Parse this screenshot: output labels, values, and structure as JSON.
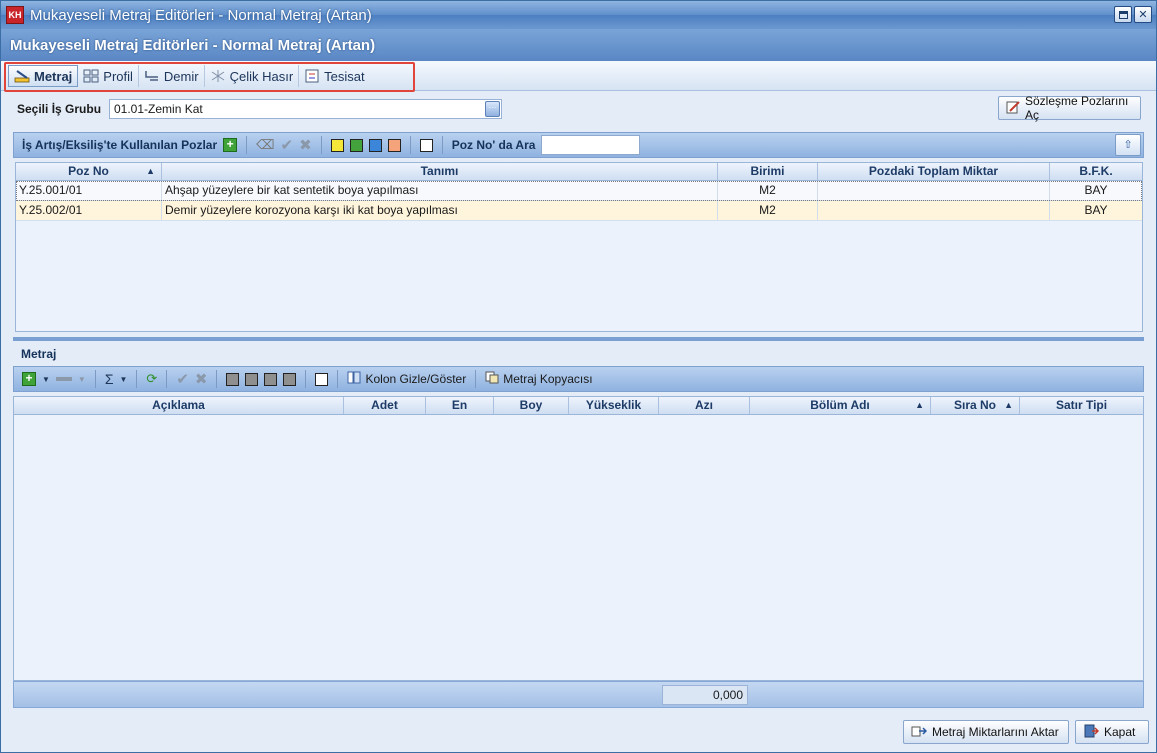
{
  "window": {
    "title": "Mukayeseli Metraj Editörleri - Normal Metraj (Artan)",
    "app_icon_text": "KH",
    "header": "Mukayeseli Metraj Editörleri - Normal Metraj (Artan)"
  },
  "tabs": [
    {
      "label": "Metraj",
      "active": true,
      "icon": "ruler-pencil-icon"
    },
    {
      "label": "Profil",
      "active": false,
      "icon": "grid-icon"
    },
    {
      "label": "Demir",
      "active": false,
      "icon": "rebar-icon"
    },
    {
      "label": "Çelik Hasır",
      "active": false,
      "icon": "mesh-icon"
    },
    {
      "label": "Tesisat",
      "active": false,
      "icon": "installation-icon"
    }
  ],
  "selection": {
    "label": "Seçili İş Grubu",
    "value": "01.01-Zemin Kat",
    "button_text": "···"
  },
  "contract_button": "Sözleşme Pozlarını Aç",
  "upper_panel": {
    "label": "İş Artış/Eksiliş'te Kullanılan Pozlar",
    "search_label": "Poz No' da Ara",
    "search_value": "",
    "colors": [
      "#f5e63a",
      "#43a23c",
      "#3b86d8",
      "#f5a37a",
      "#ffffff"
    ],
    "columns": [
      "Poz No",
      "Tanımı",
      "Birimi",
      "Pozdaki Toplam Miktar",
      "B.F.K."
    ],
    "rows": [
      {
        "poz": "Y.25.001/01",
        "tanim": "Ahşap yüzeylere bir kat sentetik boya yapılması",
        "birim": "M2",
        "miktar": "",
        "bfk": "BAY"
      },
      {
        "poz": "Y.25.002/01",
        "tanim": "Demir yüzeylere korozyona karşı iki kat boya yapılması",
        "birim": "M2",
        "miktar": "",
        "bfk": "BAY"
      }
    ]
  },
  "lower_panel": {
    "section_label": "Metraj",
    "kolon_label": "Kolon Gizle/Göster",
    "kopyaci_label": "Metraj Kopyacısı",
    "columns": [
      "Açıklama",
      "Adet",
      "En",
      "Boy",
      "Yükseklik",
      "Azı",
      "Bölüm Adı",
      "Sıra No",
      "Satır Tipi"
    ],
    "sum_value": "0,000"
  },
  "footer": {
    "aktar_label": "Metraj Miktarlarını Aktar",
    "kapat_label": "Kapat"
  }
}
